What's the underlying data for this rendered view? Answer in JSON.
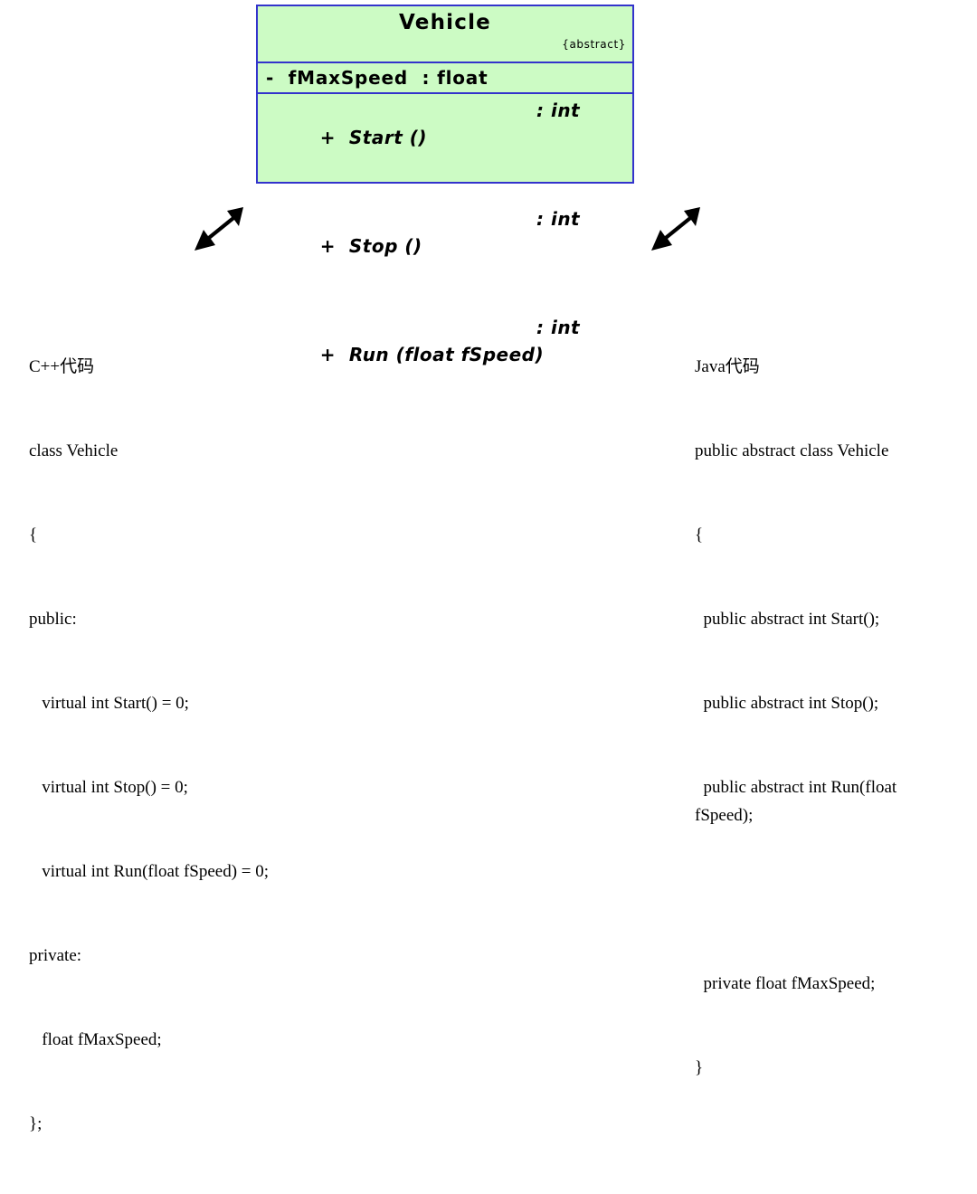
{
  "uml_class": {
    "name": "Vehicle",
    "stereotype": "{abstract}",
    "attributes": [
      {
        "visibility": "-",
        "text": "-  fMaxSpeed  : float"
      }
    ],
    "operations": [
      {
        "signature": "+  Start ()",
        "return_type": ": int"
      },
      {
        "signature": "+  Stop ()",
        "return_type": ": int"
      },
      {
        "signature": "+  Run (float fSpeed)",
        "return_type": ": int"
      }
    ],
    "colors": {
      "fill": "#ccfbc4",
      "border": "#3333cc",
      "text": "#000000"
    }
  },
  "arrows": {
    "left": {
      "name": "double-arrow-left",
      "direction": "bidirectional-diagonal"
    },
    "right": {
      "name": "double-arrow-right",
      "direction": "bidirectional-diagonal"
    }
  },
  "code_panels": [
    {
      "id": "cpp",
      "title": "C++代码",
      "lines": [
        "C++代码",
        "class Vehicle",
        "{",
        "public:",
        "   virtual int Start() = 0;",
        "   virtual int Stop() = 0;",
        "   virtual int Run(float fSpeed) = 0;",
        "private:",
        "   float fMaxSpeed;",
        "};"
      ]
    },
    {
      "id": "java",
      "title": "Java代码",
      "lines": [
        "Java代码",
        "public abstract class Vehicle",
        "{",
        "  public abstract int Start();",
        "  public abstract int Stop();",
        "  public abstract int Run(float fSpeed);",
        "",
        "  private float fMaxSpeed;",
        "}"
      ]
    }
  ]
}
